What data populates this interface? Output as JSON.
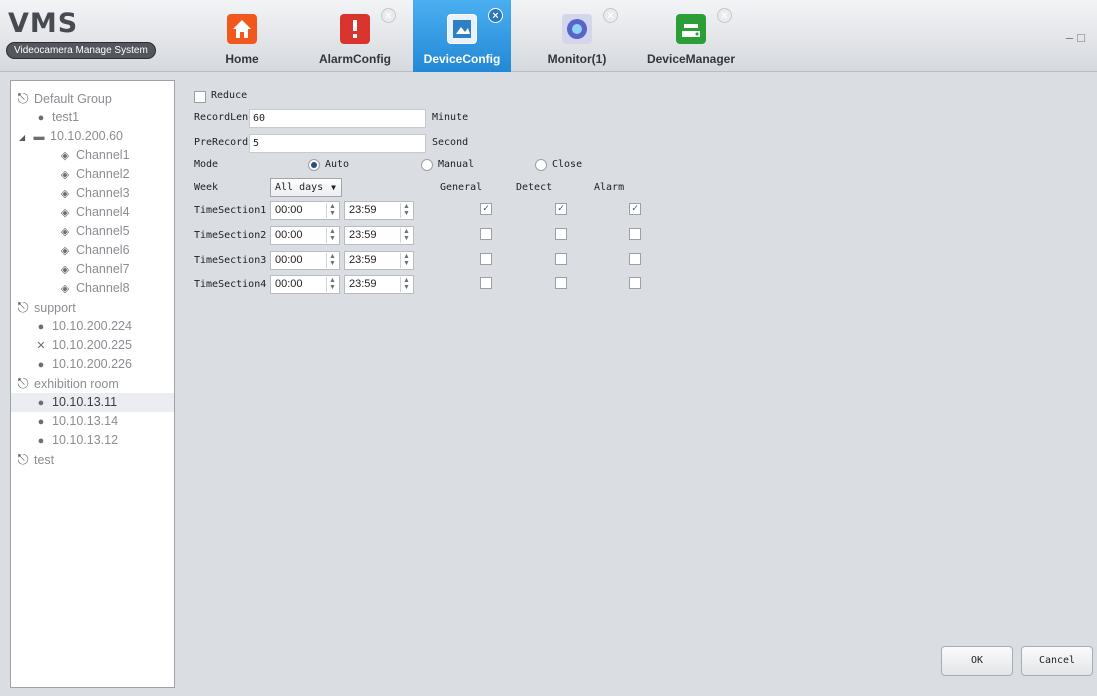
{
  "app": {
    "name": "VMS",
    "subtitle": "Videocamera Manage System"
  },
  "tabs": [
    {
      "label": "Home",
      "icon": "home-icon",
      "color": "#f0581e",
      "active": false,
      "closable": false
    },
    {
      "label": "AlarmConfig",
      "icon": "alarm-icon",
      "color": "#d9352e",
      "active": false,
      "closable": true
    },
    {
      "label": "DeviceConfig",
      "icon": "device-config-icon",
      "color": "#2e7fc6",
      "active": true,
      "closable": true
    },
    {
      "label": "Monitor(1)",
      "icon": "monitor-icon",
      "color": "#5a63c8",
      "active": false,
      "closable": true
    },
    {
      "label": "DeviceManager",
      "icon": "device-manager-icon",
      "color": "#2b9e36",
      "active": false,
      "closable": true
    }
  ],
  "window_controls": {
    "minimize": "–",
    "maximize": "□"
  },
  "tree": [
    {
      "label": "Default Group",
      "type": "group"
    },
    {
      "label": "test1",
      "type": "device"
    },
    {
      "label": "10.10.200.60",
      "type": "nvr"
    },
    {
      "label": "Channel1",
      "type": "channel"
    },
    {
      "label": "Channel2",
      "type": "channel"
    },
    {
      "label": "Channel3",
      "type": "channel"
    },
    {
      "label": "Channel4",
      "type": "channel"
    },
    {
      "label": "Channel5",
      "type": "channel"
    },
    {
      "label": "Channel6",
      "type": "channel"
    },
    {
      "label": "Channel7",
      "type": "channel"
    },
    {
      "label": "Channel8",
      "type": "channel"
    },
    {
      "label": "support",
      "type": "group"
    },
    {
      "label": "10.10.200.224",
      "type": "device"
    },
    {
      "label": "10.10.200.225",
      "type": "device-offline"
    },
    {
      "label": "10.10.200.226",
      "type": "device"
    },
    {
      "label": "exhibition room",
      "type": "group"
    },
    {
      "label": "10.10.13.11",
      "type": "device-selected"
    },
    {
      "label": "10.10.13.14",
      "type": "device"
    },
    {
      "label": "10.10.13.12",
      "type": "device"
    },
    {
      "label": "test",
      "type": "group"
    }
  ],
  "form": {
    "reduce_label": "Reduce",
    "reduce_checked": false,
    "record_len_label": "RecordLen",
    "record_len_value": "60",
    "record_len_unit": "Minute",
    "prerecord_label": "PreRecord",
    "prerecord_value": "5",
    "prerecord_unit": "Second",
    "mode_label": "Mode",
    "mode_options": [
      "Auto",
      "Manual",
      "Close"
    ],
    "mode_selected": "Auto",
    "week_label": "Week",
    "week_value": "All days",
    "col_general": "General",
    "col_detect": "Detect",
    "col_alarm": "Alarm",
    "time_sections": [
      {
        "label": "TimeSection1",
        "start": "00:00",
        "end": "23:59",
        "general": true,
        "detect": true,
        "alarm": true
      },
      {
        "label": "TimeSection2",
        "start": "00:00",
        "end": "23:59",
        "general": false,
        "detect": false,
        "alarm": false
      },
      {
        "label": "TimeSection3",
        "start": "00:00",
        "end": "23:59",
        "general": false,
        "detect": false,
        "alarm": false
      },
      {
        "label": "TimeSection4",
        "start": "00:00",
        "end": "23:59",
        "general": false,
        "detect": false,
        "alarm": false
      }
    ]
  },
  "buttons": {
    "ok": "OK",
    "cancel": "Cancel"
  },
  "colors": {
    "accent": "#2389d6",
    "header_bg": "#e6e8eb",
    "body_bg": "#dadde2"
  }
}
